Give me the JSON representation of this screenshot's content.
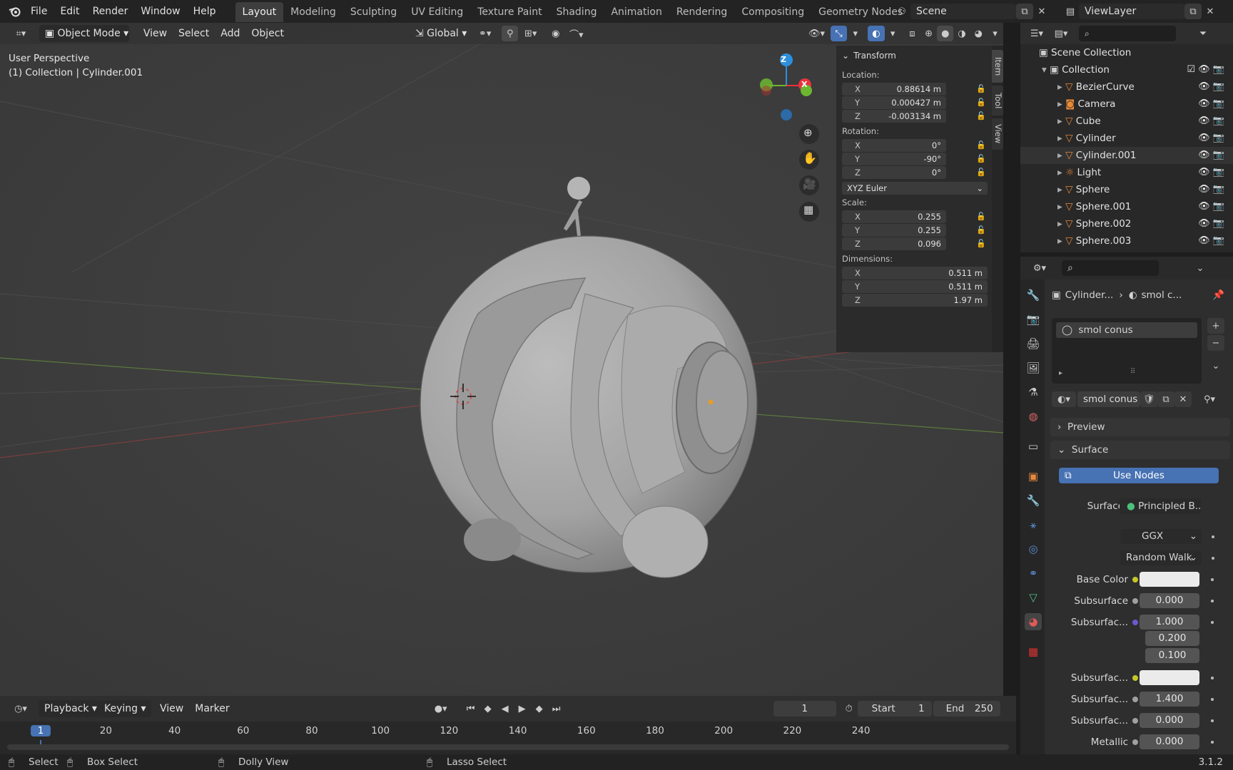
{
  "topbar": {
    "menus": [
      "File",
      "Edit",
      "Render",
      "Window",
      "Help"
    ],
    "workspaces": [
      "Layout",
      "Modeling",
      "Sculpting",
      "UV Editing",
      "Texture Paint",
      "Shading",
      "Animation",
      "Rendering",
      "Compositing",
      "Geometry Nodes"
    ],
    "scene": "Scene",
    "view_layer": "ViewLayer"
  },
  "viewport_header": {
    "mode": "Object Mode",
    "menus": [
      "View",
      "Select",
      "Add",
      "Object"
    ],
    "transform_orientation": "Global"
  },
  "viewport": {
    "perspective": "User Perspective",
    "context": "(1) Collection | Cylinder.001",
    "gizmo": {
      "x": "X",
      "y": "Y",
      "z": "Z"
    }
  },
  "npanel": {
    "title": "Transform",
    "location_label": "Location:",
    "location": [
      {
        "axis": "X",
        "value": "0.88614 m"
      },
      {
        "axis": "Y",
        "value": "0.000427 m"
      },
      {
        "axis": "Z",
        "value": "-0.003134 m"
      }
    ],
    "rotation_label": "Rotation:",
    "rotation": [
      {
        "axis": "X",
        "value": "0°"
      },
      {
        "axis": "Y",
        "value": "-90°"
      },
      {
        "axis": "Z",
        "value": "0°"
      }
    ],
    "rotation_mode": "XYZ Euler",
    "scale_label": "Scale:",
    "scale": [
      {
        "axis": "X",
        "value": "0.255"
      },
      {
        "axis": "Y",
        "value": "0.255"
      },
      {
        "axis": "Z",
        "value": "0.096"
      }
    ],
    "dimensions_label": "Dimensions:",
    "dimensions": [
      {
        "axis": "X",
        "value": "0.511 m"
      },
      {
        "axis": "Y",
        "value": "0.511 m"
      },
      {
        "axis": "Z",
        "value": "1.97 m"
      }
    ],
    "tabs": [
      "Item",
      "Tool",
      "View"
    ]
  },
  "outliner": {
    "root": "Scene Collection",
    "collection": "Collection",
    "items": [
      "BezierCurve",
      "Camera",
      "Cube",
      "Cylinder",
      "Cylinder.001",
      "Light",
      "Sphere",
      "Sphere.001",
      "Sphere.002",
      "Sphere.003"
    ]
  },
  "properties": {
    "breadcrumb_object": "Cylinder...",
    "breadcrumb_material": "smol c...",
    "material_slot": "smol conus",
    "material_name": "smol conus",
    "preview_label": "Preview",
    "surface_panel": "Surface",
    "use_nodes": "Use Nodes",
    "surface_label": "Surface",
    "surface_shader": "Principled B...",
    "distribution": "GGX",
    "subsurface_method": "Random Walk",
    "rows": [
      {
        "label": "Base Color",
        "value": "",
        "dot": "#c7c729",
        "swatch": "#ebebeb"
      },
      {
        "label": "Subsurface",
        "value": "0.000",
        "dot": "#a0a0a0"
      },
      {
        "label": "Subsurfac...",
        "value": "1.000",
        "dot": "#6a5acd"
      },
      {
        "label": "",
        "value": "0.200"
      },
      {
        "label": "",
        "value": "0.100"
      },
      {
        "label": "Subsurfac...",
        "value": "",
        "dot": "#c7c729",
        "swatch": "#ebebeb"
      },
      {
        "label": "Subsurfac...",
        "value": "1.400",
        "dot": "#a0a0a0"
      },
      {
        "label": "Subsurfac...",
        "value": "0.000",
        "dot": "#a0a0a0"
      },
      {
        "label": "Metallic",
        "value": "0.000",
        "dot": "#a0a0a0"
      }
    ]
  },
  "timeline": {
    "menus": [
      "Playback",
      "Keying",
      "View",
      "Marker"
    ],
    "current_frame": "1",
    "start_label": "Start",
    "start": "1",
    "end_label": "End",
    "end": "250",
    "ruler": [
      "1",
      "20",
      "40",
      "60",
      "80",
      "100",
      "120",
      "140",
      "160",
      "180",
      "200",
      "220",
      "240"
    ],
    "ruler_frames": [
      1,
      20,
      40,
      60,
      80,
      100,
      120,
      140,
      160,
      180,
      200,
      220,
      240
    ]
  },
  "statusbar": {
    "select": "Select",
    "box_select": "Box Select",
    "dolly": "Dolly View",
    "lasso": "Lasso Select",
    "version": "3.1.2"
  },
  "colors": {
    "accent": "#4772b3",
    "x_axis": "#e8333d",
    "y_axis": "#6cb72f",
    "z_axis": "#2c8fdd"
  }
}
